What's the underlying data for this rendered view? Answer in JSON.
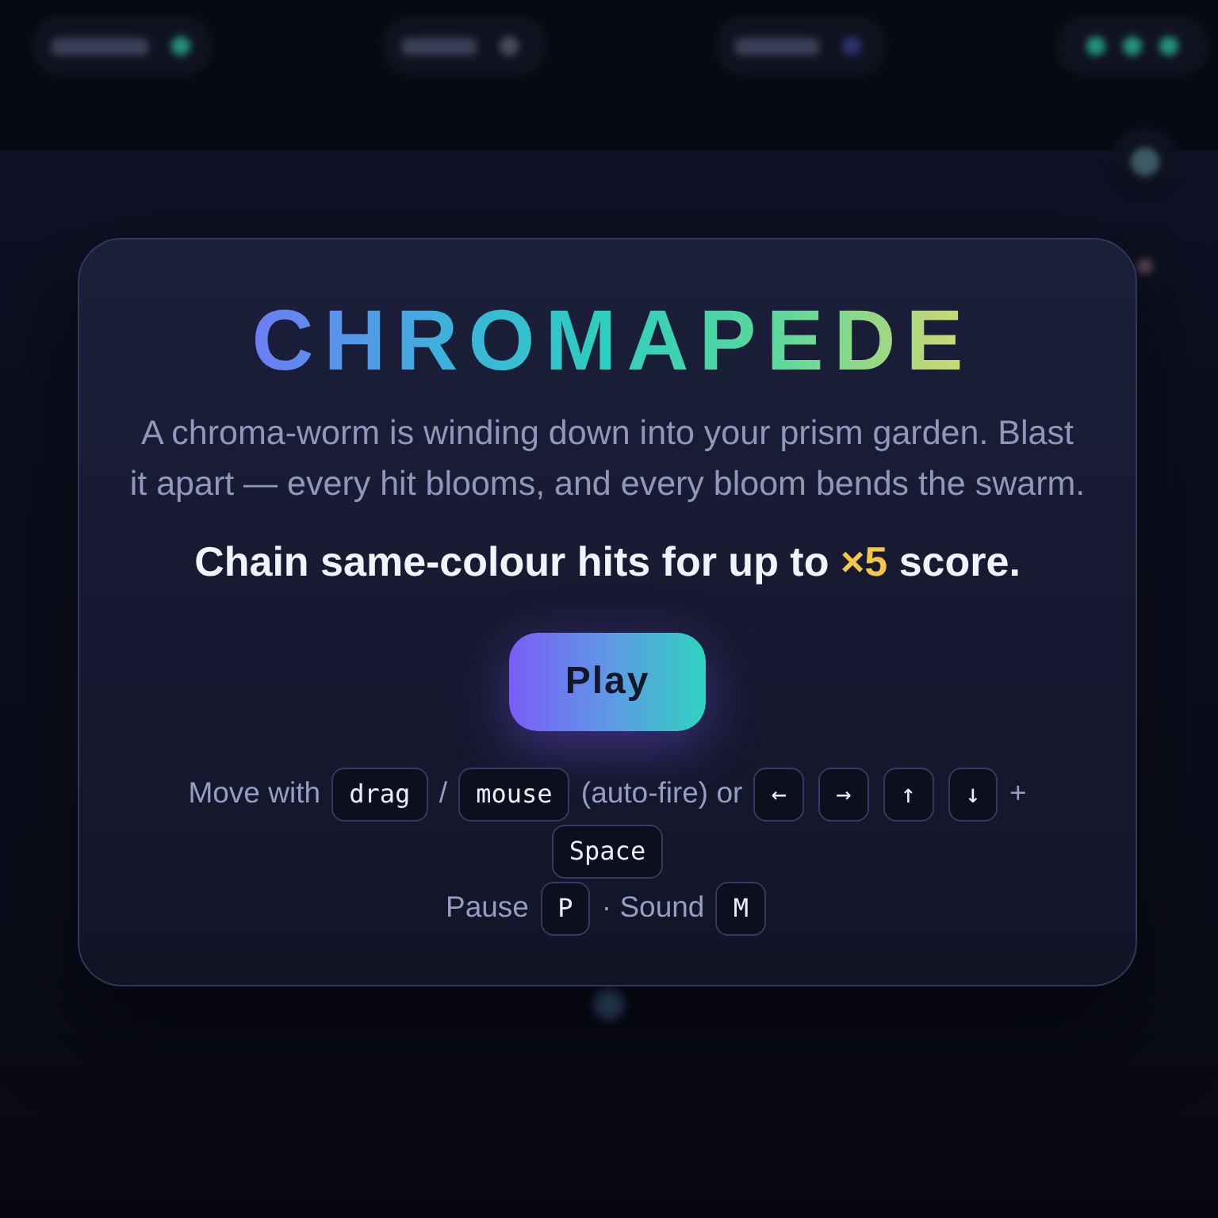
{
  "title": "CHROMAPEDE",
  "description": "A chroma-worm is winding down into your prism garden. Blast it apart — every hit blooms, and every bloom bends the swarm.",
  "tagline": {
    "lead": "Chain same-colour hits for up to",
    "highlight": "×5",
    "tail": "score."
  },
  "play_button": "Play",
  "controls": [
    {
      "parts": [
        {
          "kind": "text",
          "text": "Move with"
        },
        {
          "kind": "key",
          "text": "drag"
        },
        {
          "kind": "text",
          "text": "/"
        },
        {
          "kind": "key",
          "text": "mouse"
        },
        {
          "kind": "text",
          "text": "(auto-fire) or"
        },
        {
          "kind": "key",
          "text": "←"
        },
        {
          "kind": "key",
          "text": "→"
        },
        {
          "kind": "key",
          "text": "↑"
        },
        {
          "kind": "key",
          "text": "↓"
        },
        {
          "kind": "text",
          "text": "+"
        },
        {
          "kind": "key",
          "text": "Space"
        }
      ]
    },
    {
      "parts": [
        {
          "kind": "text",
          "text": "Pause"
        },
        {
          "kind": "key",
          "text": "P"
        },
        {
          "kind": "text",
          "text": "· Sound"
        },
        {
          "kind": "key",
          "text": "M"
        }
      ]
    }
  ]
}
